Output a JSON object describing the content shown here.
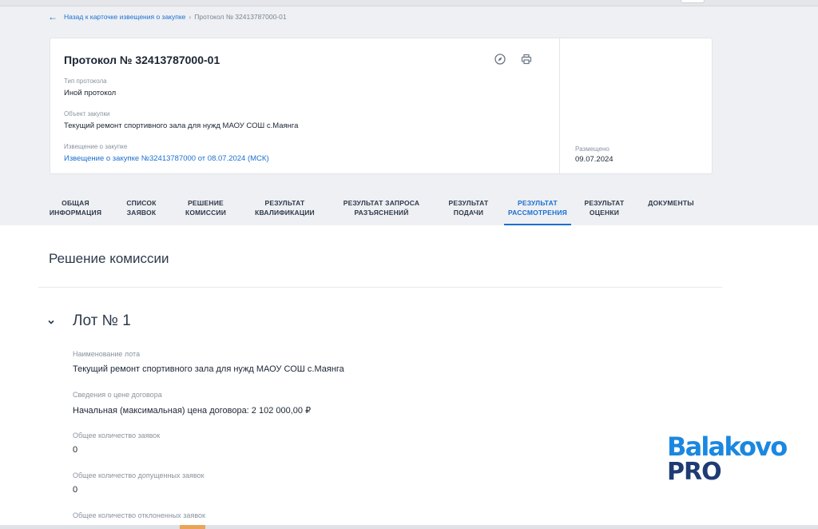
{
  "breadcrumb": {
    "back_link": "Назад к карточке извещения о закупке",
    "separator": "›",
    "current": "Протокол № 32413787000-01"
  },
  "card": {
    "title": "Протокол № 32413787000-01",
    "icons": [
      "compass-icon",
      "print-icon"
    ],
    "protocol_type_label": "Тип протокола",
    "protocol_type_value": "Иной протокол",
    "object_label": "Объект закупки",
    "object_value": "Текущий ремонт спортивного зала для нужд МАОУ СОШ с.Маянга",
    "notice_label": "Извещение о закупке",
    "notice_link": "Извещение о закупке №32413787000 от 08.07.2024 (МСК)",
    "posted_label": "Размещено",
    "posted_value": "09.07.2024"
  },
  "tabs": [
    {
      "line1": "ОБЩАЯ",
      "line2": "ИНФОРМАЦИЯ",
      "active": false
    },
    {
      "line1": "СПИСОК",
      "line2": "ЗАЯВОК",
      "active": false
    },
    {
      "line1": "РЕШЕНИЕ",
      "line2": "КОМИССИИ",
      "active": false
    },
    {
      "line1": "РЕЗУЛЬТАТ",
      "line2": "КВАЛИФИКАЦИИ",
      "active": false
    },
    {
      "line1": "РЕЗУЛЬТАТ ЗАПРОСА",
      "line2": "РАЗЪЯСНЕНИЙ",
      "active": false
    },
    {
      "line1": "РЕЗУЛЬТАТ",
      "line2": "ПОДАЧИ",
      "active": false
    },
    {
      "line1": "РЕЗУЛЬТАТ",
      "line2": "РАССМОТРЕНИЯ",
      "active": true
    },
    {
      "line1": "РЕЗУЛЬТАТ",
      "line2": "ОЦЕНКИ",
      "active": false
    },
    {
      "line1": "ДОКУМЕНТЫ",
      "line2": "",
      "active": false
    }
  ],
  "section": {
    "title": "Решение комиссии"
  },
  "lot": {
    "title": "Лот № 1",
    "name_label": "Наименование лота",
    "name_value": "Текущий ремонт спортивного зала для нужд МАОУ СОШ с.Маянга",
    "price_label": "Сведения о цене договора",
    "price_value": "Начальная (максимальная) цена договора: 2 102 000,00 ₽",
    "total_label": "Общее количество заявок",
    "total_value": "0",
    "admitted_label": "Общее количество допущенных заявок",
    "admitted_value": "0",
    "rejected_label": "Общее количество отклоненных заявок"
  },
  "watermark": {
    "line1": "Balakovo",
    "line2": "PRO"
  },
  "colors": {
    "accent": "#1b6fd1",
    "page_grey": "#eef0f3",
    "watermark_blue": "#1a88e0",
    "watermark_navy": "#1f3b73"
  }
}
